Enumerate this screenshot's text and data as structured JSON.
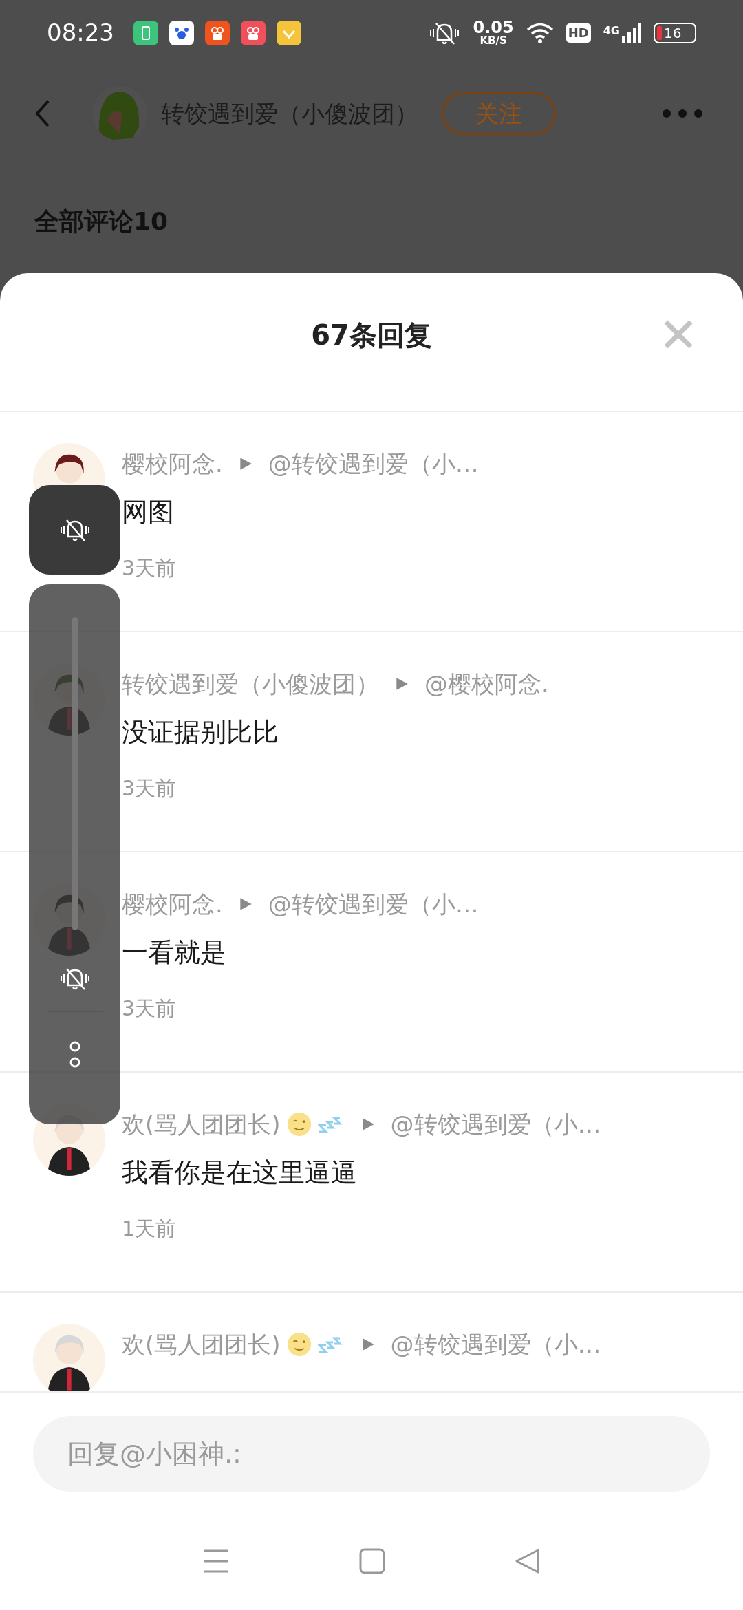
{
  "status_bar": {
    "time": "08:23",
    "net_speed": "0.05",
    "net_unit": "KB/S",
    "hd": "HD",
    "network": "4G",
    "battery": "16"
  },
  "header": {
    "user_name": "转饺遇到爱（小傻波团）",
    "follow": "关注"
  },
  "comments_heading": "全部评论10",
  "sheet": {
    "title": "67条回复"
  },
  "replies": [
    {
      "author": "樱校阿念.",
      "target": "@转饺遇到爱（小…",
      "text": "网图",
      "time": "3天前",
      "status_emoji": false
    },
    {
      "author": "转饺遇到爱（小傻波团）",
      "target": "@樱校阿念.",
      "text": "没证据别比比",
      "time": "3天前",
      "status_emoji": false
    },
    {
      "author": "樱校阿念.",
      "target": "@转饺遇到爱（小…",
      "text": "一看就是",
      "time": "3天前",
      "status_emoji": false
    },
    {
      "author": "欢(骂人团团长)",
      "target": "@转饺遇到爱（小…",
      "text": "我看你是在这里逼逼",
      "time": "1天前",
      "status_emoji": true
    },
    {
      "author": "欢(骂人团团长)",
      "target": "@转饺遇到爱（小…",
      "status_emoji": true
    }
  ],
  "reply_box": {
    "placeholder": "回复@小困神.:"
  },
  "volume_panel": {
    "muted": true
  }
}
